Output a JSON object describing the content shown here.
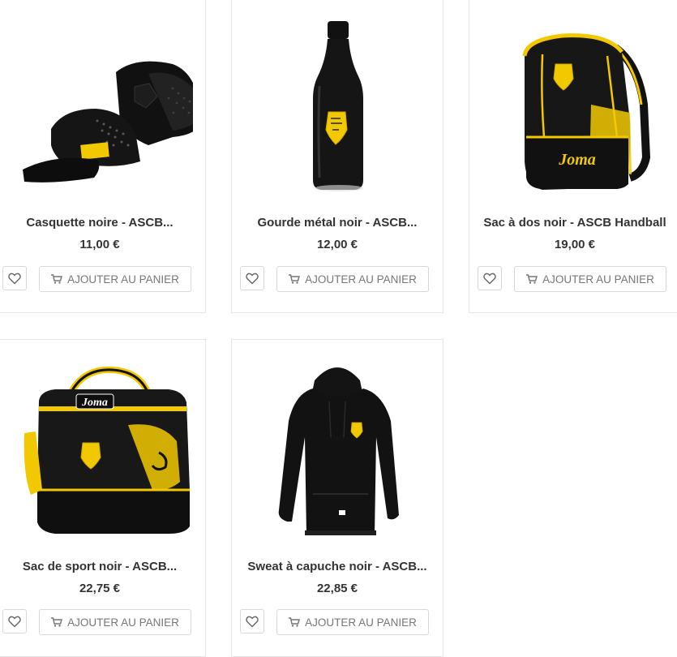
{
  "products": [
    {
      "name": "Casquette noire - ASCB...",
      "price": "11,00 €",
      "image": "black-cap-image"
    },
    {
      "name": "Gourde métal noir - ASCB...",
      "price": "12,00 €",
      "image": "black-bottle-image"
    },
    {
      "name": "Sac à dos noir - ASCB Handball",
      "price": "19,00 €",
      "image": "black-backpack-image",
      "brand_text": "Joma"
    },
    {
      "name": "Sac de sport noir - ASCB...",
      "price": "22,75 €",
      "image": "sport-bag-image",
      "brand_text": "Joma"
    },
    {
      "name": "Sweat à capuche noir - ASCB...",
      "price": "22,85 €",
      "image": "hoodie-image"
    }
  ],
  "buttons": {
    "add_to_cart": "AJOUTER AU PANIER"
  },
  "icons": {
    "wishlist": "heart-icon",
    "cart": "cart-icon"
  },
  "colors": {
    "accent": "#f2c900",
    "product": "#111111",
    "text": "#333333",
    "button_text": "#777777"
  }
}
